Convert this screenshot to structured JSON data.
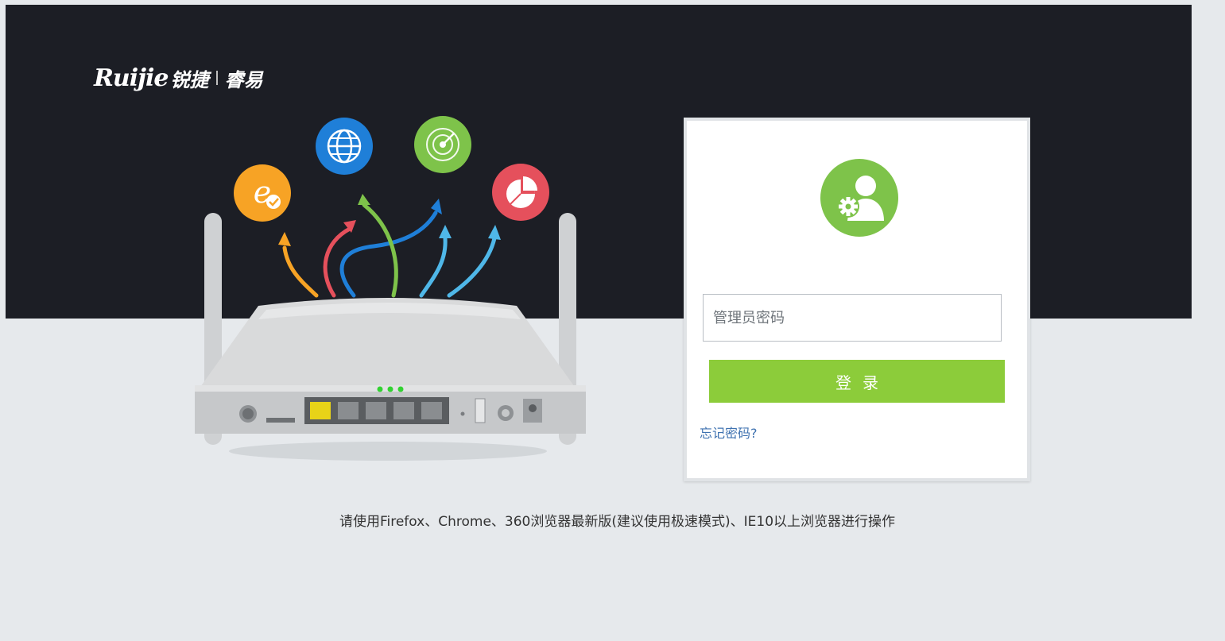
{
  "brand": {
    "logo_en": "Ruijie",
    "logo_cn": "锐捷",
    "logo_product": "睿易"
  },
  "illustration": {
    "icons": [
      "ie-browser-icon",
      "globe-icon",
      "radar-icon",
      "pie-chart-icon"
    ],
    "colors": {
      "orange": "#f7a325",
      "blue": "#1f7fd8",
      "green": "#7ec34a",
      "red": "#e5505c",
      "light_blue": "#4fb7e8"
    }
  },
  "login": {
    "avatar_icon": "admin-user-gear-icon",
    "password_placeholder": "管理员密码",
    "login_button": "登录",
    "forgot_link": "忘记密码?"
  },
  "footer": {
    "browser_hint": "请使用Firefox、Chrome、360浏览器最新版(建议使用极速模式)、IE10以上浏览器进行操作"
  },
  "colors": {
    "hero_background": "#1c1e25",
    "page_background": "#e6e9ec",
    "accent_green": "#8ccc3a",
    "link_blue": "#3f72b0"
  }
}
